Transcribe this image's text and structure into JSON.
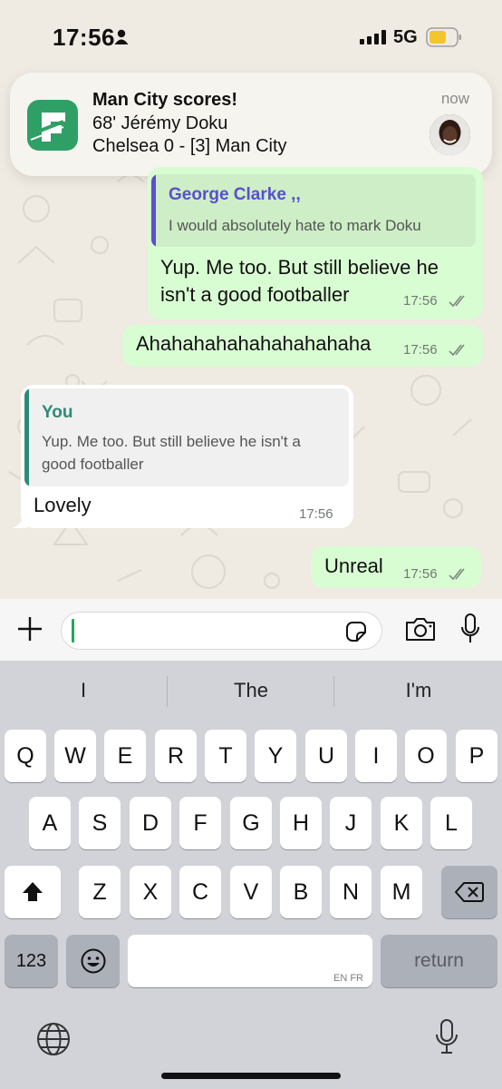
{
  "status_bar": {
    "time": "17:56",
    "network": "5G"
  },
  "notification": {
    "title": "Man City scores!",
    "line1": "68' Jérémy Doku",
    "line2": "Chelsea 0 - [3] Man City",
    "time": "now"
  },
  "messages": [
    {
      "direction": "outgoing",
      "quote_name": "George Clarke ,,",
      "quote_text": "I would absolutely hate to mark Doku",
      "text_line1": "Yup. Me too. But still believe he",
      "text_line2": "isn't a good footballer",
      "time": "17:56",
      "status": "read"
    },
    {
      "direction": "outgoing",
      "text": "Ahahahahahahahahahaha",
      "time": "17:56",
      "status": "read"
    },
    {
      "direction": "incoming",
      "quote_name": "You",
      "quote_text_line1": "Yup. Me too. But still believe he isn't a",
      "quote_text_line2": "good footballer",
      "text": "Lovely",
      "time": "17:56"
    },
    {
      "direction": "outgoing",
      "text": "Unreal",
      "time": "17:56",
      "status": "read"
    }
  ],
  "input": {
    "value": "",
    "placeholder": ""
  },
  "keyboard": {
    "suggestions": [
      "I",
      "The",
      "I'm"
    ],
    "row1": [
      "Q",
      "W",
      "E",
      "R",
      "T",
      "Y",
      "U",
      "I",
      "O",
      "P"
    ],
    "row2": [
      "A",
      "S",
      "D",
      "F",
      "G",
      "H",
      "J",
      "K",
      "L"
    ],
    "row3": [
      "Z",
      "X",
      "C",
      "V",
      "B",
      "N",
      "M"
    ],
    "numbers_label": "123",
    "space_lang": "EN FR",
    "return_label": "return"
  },
  "colors": {
    "outgoing_bubble": "#d9fdd3",
    "incoming_bubble": "#ffffff",
    "quote_name_purple": "#5a4fcf",
    "quote_name_teal": "#2e8a78",
    "app_icon_green": "#2fa065",
    "caret_green": "#23a55a"
  }
}
